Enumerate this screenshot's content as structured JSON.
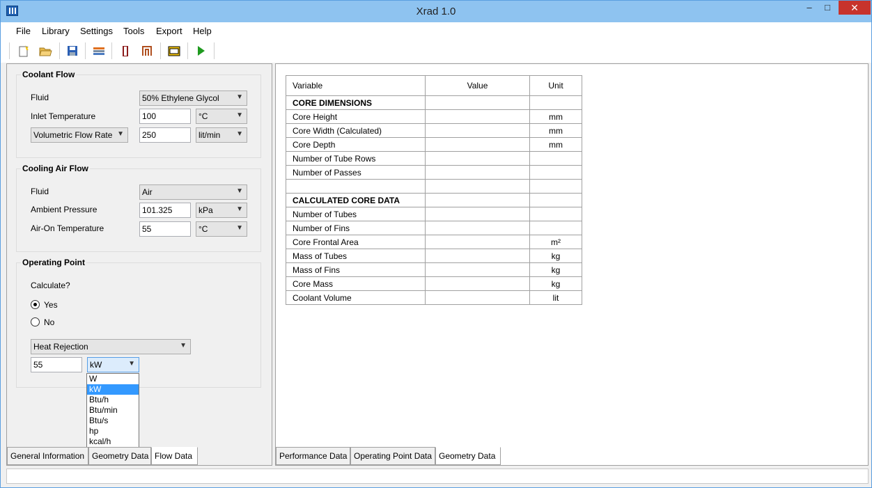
{
  "window": {
    "title": "Xrad 1.0",
    "minimize": "–",
    "maximize": "□",
    "close": "✕"
  },
  "menu": [
    "File",
    "Library",
    "Settings",
    "Tools",
    "Export",
    "Help"
  ],
  "toolbar": {
    "buttons": [
      {
        "icon": "new-file-icon"
      },
      {
        "icon": "open-folder-icon"
      },
      {
        "icon": "save-icon"
      },
      {
        "icon": "layers-icon"
      },
      {
        "icon": "red-bar-icon"
      },
      {
        "icon": "tube-icon"
      },
      {
        "icon": "panel-icon"
      },
      {
        "icon": "run-icon"
      }
    ]
  },
  "coolant_flow": {
    "title": "Coolant Flow",
    "fluid_label": "Fluid",
    "fluid_value": "50% Ethylene Glycol",
    "inlet_label": "Inlet Temperature",
    "inlet_value": "100",
    "inlet_unit": "°C",
    "flow_type": "Volumetric Flow Rate",
    "flow_value": "250",
    "flow_unit": "lit/min"
  },
  "cooling_air": {
    "title": "Cooling Air Flow",
    "fluid_label": "Fluid",
    "fluid_value": "Air",
    "pressure_label": "Ambient Pressure",
    "pressure_value": "101.325",
    "pressure_unit": "kPa",
    "airon_label": "Air-On Temperature",
    "airon_value": "55",
    "airon_unit": "°C"
  },
  "operating_point": {
    "title": "Operating Point",
    "calc_label": "Calculate?",
    "yes_label": "Yes",
    "no_label": "No",
    "selected": "Yes",
    "mode_value": "Heat Rejection",
    "value": "55",
    "unit": "kW",
    "unit_options": [
      "W",
      "kW",
      "Btu/h",
      "Btu/min",
      "Btu/s",
      "hp",
      "kcal/h"
    ],
    "highlighted_option": "kW"
  },
  "left_tabs": [
    "General Information",
    "Geometry Data",
    "Flow Data"
  ],
  "left_active_tab": "Flow Data",
  "right_tabs": [
    "Performance Data",
    "Operating Point Data",
    "Geometry Data"
  ],
  "right_active_tab": "Geometry Data",
  "table": {
    "headers": [
      "Variable",
      "Value",
      "Unit"
    ],
    "rows": [
      {
        "variable": "CORE DIMENSIONS",
        "value": "",
        "unit": "",
        "section": true
      },
      {
        "variable": "Core Height",
        "value": "",
        "unit": "mm"
      },
      {
        "variable": "Core Width (Calculated)",
        "value": "",
        "unit": "mm"
      },
      {
        "variable": "Core Depth",
        "value": "",
        "unit": "mm"
      },
      {
        "variable": "Number of Tube Rows",
        "value": "",
        "unit": ""
      },
      {
        "variable": "Number of Passes",
        "value": "",
        "unit": ""
      },
      {
        "variable": "",
        "value": "",
        "unit": ""
      },
      {
        "variable": "CALCULATED CORE DATA",
        "value": "",
        "unit": "",
        "section": true
      },
      {
        "variable": "Number of Tubes",
        "value": "",
        "unit": ""
      },
      {
        "variable": "Number of Fins",
        "value": "",
        "unit": ""
      },
      {
        "variable": "Core Frontal Area",
        "value": "",
        "unit": "m²"
      },
      {
        "variable": "Mass of Tubes",
        "value": "",
        "unit": "kg"
      },
      {
        "variable": "Mass of Fins",
        "value": "",
        "unit": "kg"
      },
      {
        "variable": "Core Mass",
        "value": "",
        "unit": "kg"
      },
      {
        "variable": "Coolant Volume",
        "value": "",
        "unit": "lit"
      }
    ]
  }
}
